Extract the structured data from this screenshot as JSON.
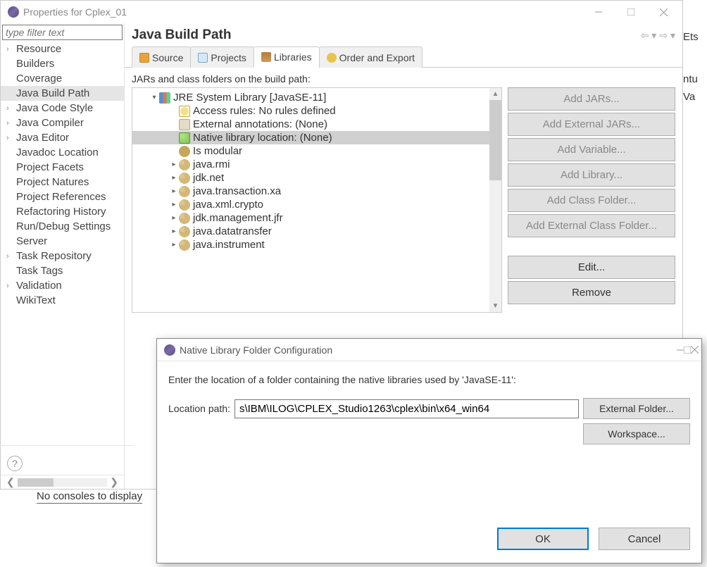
{
  "window": {
    "title": "Properties for Cplex_01"
  },
  "filter_placeholder": "type filter text",
  "nav": {
    "items": [
      {
        "label": "Resource",
        "arrow": true
      },
      {
        "label": "Builders",
        "arrow": false
      },
      {
        "label": "Coverage",
        "arrow": false
      },
      {
        "label": "Java Build Path",
        "arrow": false,
        "selected": true
      },
      {
        "label": "Java Code Style",
        "arrow": true
      },
      {
        "label": "Java Compiler",
        "arrow": true
      },
      {
        "label": "Java Editor",
        "arrow": true
      },
      {
        "label": "Javadoc Location",
        "arrow": false
      },
      {
        "label": "Project Facets",
        "arrow": false
      },
      {
        "label": "Project Natures",
        "arrow": false
      },
      {
        "label": "Project References",
        "arrow": false
      },
      {
        "label": "Refactoring History",
        "arrow": false
      },
      {
        "label": "Run/Debug Settings",
        "arrow": false
      },
      {
        "label": "Server",
        "arrow": false
      },
      {
        "label": "Task Repository",
        "arrow": true
      },
      {
        "label": "Task Tags",
        "arrow": false
      },
      {
        "label": "Validation",
        "arrow": true
      },
      {
        "label": "WikiText",
        "arrow": false
      }
    ]
  },
  "page": {
    "title": "Java Build Path",
    "tabs": [
      {
        "label": "Source"
      },
      {
        "label": "Projects"
      },
      {
        "label": "Libraries",
        "active": true
      },
      {
        "label": "Order and Export"
      }
    ],
    "lib_desc": "JARs and class folders on the build path:",
    "tree": [
      {
        "indent": 0,
        "twisty": "down",
        "icon": "books",
        "label": "JRE System Library [JavaSE-11]"
      },
      {
        "indent": 1,
        "twisty": "",
        "icon": "rule",
        "label": "Access rules: No rules defined"
      },
      {
        "indent": 1,
        "twisty": "",
        "icon": "annot",
        "label": "External annotations: (None)"
      },
      {
        "indent": 1,
        "twisty": "",
        "icon": "native",
        "label": "Native library location: (None)",
        "selected": true
      },
      {
        "indent": 1,
        "twisty": "",
        "icon": "mod",
        "label": "Is modular"
      },
      {
        "indent": 1,
        "twisty": "right",
        "icon": "pkg",
        "label": "java.rmi"
      },
      {
        "indent": 1,
        "twisty": "right",
        "icon": "pkg",
        "label": "jdk.net"
      },
      {
        "indent": 1,
        "twisty": "right",
        "icon": "pkg",
        "label": "java.transaction.xa"
      },
      {
        "indent": 1,
        "twisty": "right",
        "icon": "pkg",
        "label": "java.xml.crypto"
      },
      {
        "indent": 1,
        "twisty": "right",
        "icon": "pkg",
        "label": "jdk.management.jfr"
      },
      {
        "indent": 1,
        "twisty": "right",
        "icon": "pkg",
        "label": "java.datatransfer"
      },
      {
        "indent": 1,
        "twisty": "right",
        "icon": "pkg",
        "label": "java.instrument"
      }
    ],
    "buttons": {
      "add_jars": "Add JARs...",
      "add_ext_jars": "Add External JARs...",
      "add_var": "Add Variable...",
      "add_lib": "Add Library...",
      "add_cf": "Add Class Folder...",
      "add_ext_cf": "Add External Class Folder...",
      "edit": "Edit...",
      "remove": "Remove"
    }
  },
  "dialog": {
    "title": "Native Library Folder Configuration",
    "text": "Enter the location of a folder containing the native libraries used by 'JavaSE-11':",
    "path_label": "Location path:",
    "path_value": "s\\IBM\\ILOG\\CPLEX_Studio1263\\cplex\\bin\\x64_win64",
    "external_folder_btn": "External Folder...",
    "workspace_btn": "Workspace...",
    "ok": "OK",
    "cancel": "Cancel"
  },
  "console": "No consoles to display",
  "rightedge": {
    "et": "Ets",
    "l1": "ntu",
    "l2": "Va"
  }
}
